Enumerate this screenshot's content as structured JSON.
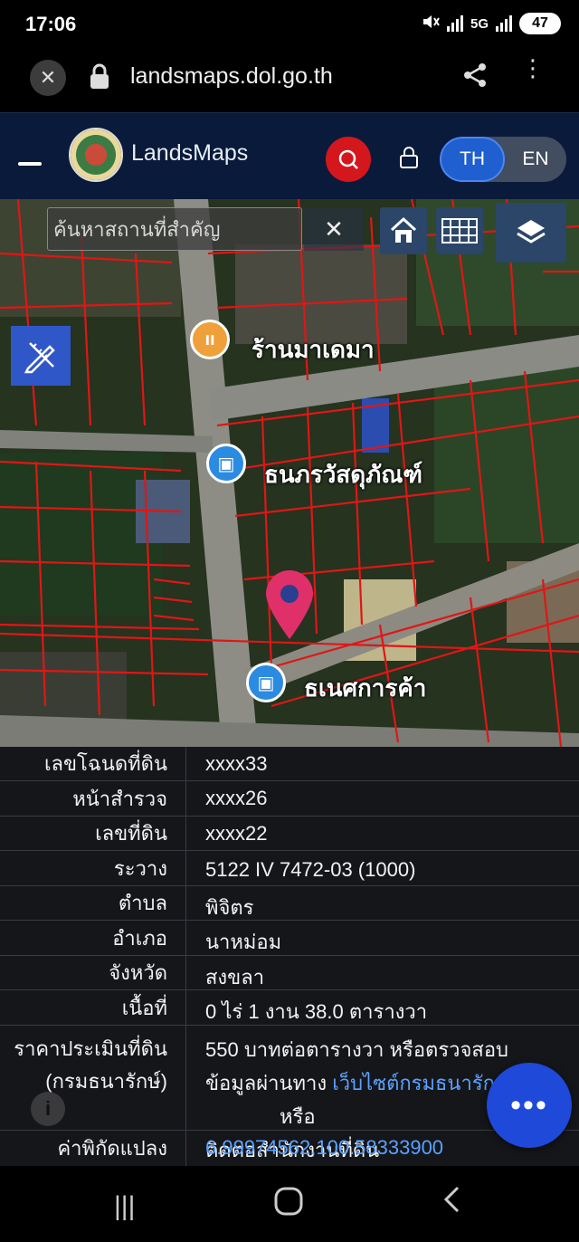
{
  "status_bar": {
    "time": "17:06",
    "network": "5G",
    "battery": "47"
  },
  "browser": {
    "url": "landsmaps.dol.go.th"
  },
  "app": {
    "brand": "LandsMaps",
    "lang_th": "TH",
    "lang_en": "EN",
    "active_lang": "TH"
  },
  "map": {
    "search_placeholder": "ค้นหาสถานที่สำคัญ",
    "clear_symbol": "✕",
    "poi_labels": [
      "ร้านมาเดมา",
      "ธนภรวัสดุภัณฑ์",
      "ธเนศการค้า"
    ],
    "poi_colors": [
      "#f0a03a",
      "#2b8be0",
      "#2b8be0"
    ],
    "marker_color": "#e0306a",
    "parcel_line_color": "#e01616"
  },
  "parcel": {
    "rows": [
      {
        "label": "เลขโฉนดที่ดิน",
        "value": "xxxx33"
      },
      {
        "label": "หน้าสำรวจ",
        "value": "xxxx26"
      },
      {
        "label": "เลขที่ดิน",
        "value": "xxxx22"
      },
      {
        "label": "ระวาง",
        "value": "5122 IV 7472-03 (1000)"
      },
      {
        "label": "ตำบล",
        "value": "พิจิตร"
      },
      {
        "label": "อำเภอ",
        "value": "นาหม่อม"
      },
      {
        "label": "จังหวัด",
        "value": "สงขลา"
      },
      {
        "label": "เนื้อที่",
        "value": "0 ไร่ 1 งาน 38.0 ตารางวา"
      }
    ],
    "price": {
      "label_line1": "ราคาประเมินที่ดิน",
      "label_line2": "(กรมธนารักษ์)",
      "line1": "550 บาทต่อตารางวา หรือตรวจสอบ",
      "line2_prefix": "ข้อมูลผ่านทาง ",
      "line2_link": "เว็บไซต์กรมธนารัก",
      "line2_suffix": "หรือ",
      "line3": "ติดต่อสำนักงานที่ดิน"
    },
    "coordinates": {
      "label": "ค่าพิกัดแปลง",
      "value": "6.99974562,100.58333900"
    }
  },
  "fab_label": "•••",
  "info_button_label": "i"
}
